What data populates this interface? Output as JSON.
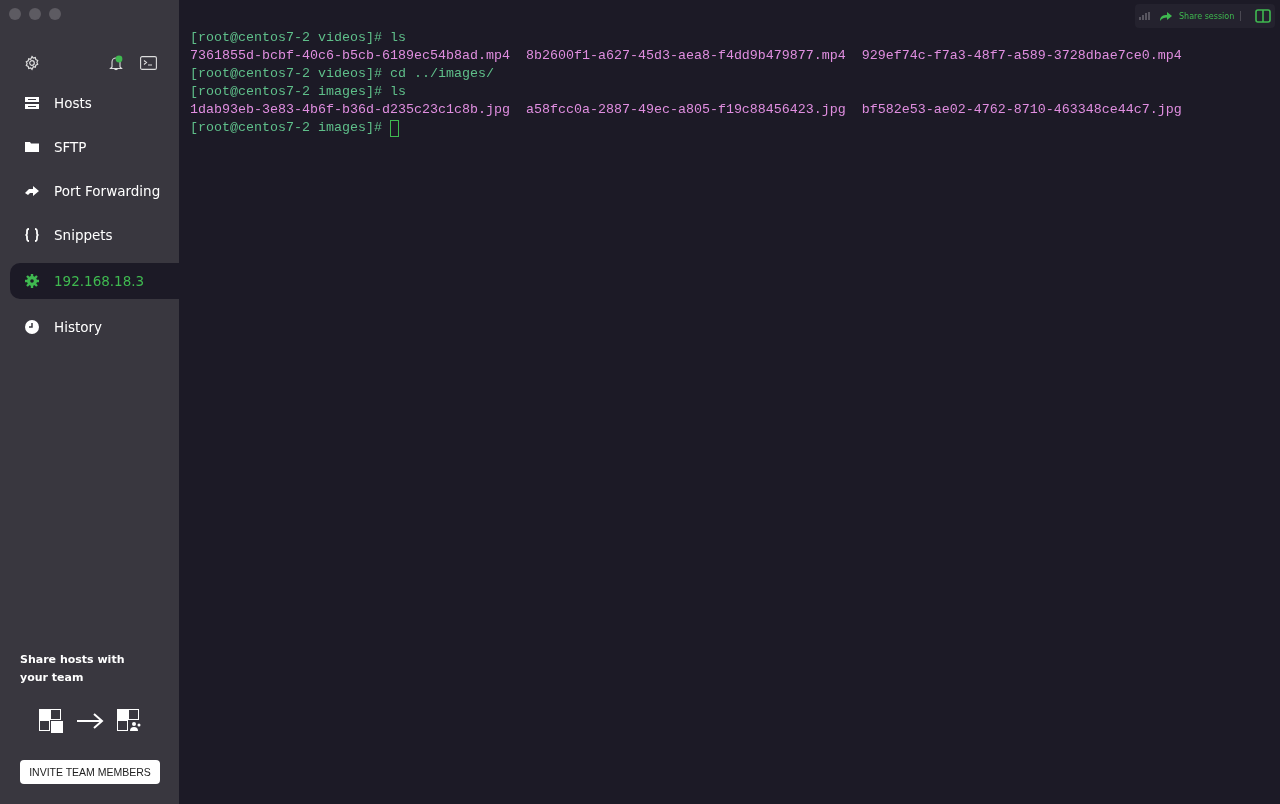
{
  "sidebar": {
    "items": [
      {
        "label": "Hosts",
        "kind": "hosts",
        "selected": false
      },
      {
        "label": "SFTP",
        "kind": "folder",
        "selected": false
      },
      {
        "label": "Port Forwarding",
        "kind": "forward",
        "selected": false
      },
      {
        "label": "Snippets",
        "kind": "braces",
        "selected": false
      },
      {
        "label": "192.168.18.3",
        "kind": "session",
        "selected": true
      },
      {
        "label": "History",
        "kind": "clock",
        "selected": false
      }
    ],
    "notifications_unread": true,
    "promo": {
      "title": "Share hosts with your team",
      "button": "INVITE TEAM MEMBERS"
    }
  },
  "toolbar": {
    "share_label": "Share session"
  },
  "terminal": {
    "lines": [
      {
        "kind": "prompt",
        "prompt": "[root@centos7-2 videos]# ",
        "command": "ls"
      },
      {
        "kind": "output",
        "text": "7361855d-bcbf-40c6-b5cb-6189ec54b8ad.mp4  8b2600f1-a627-45d3-aea8-f4dd9b479877.mp4  929ef74c-f7a3-48f7-a589-3728dbae7ce0.mp4"
      },
      {
        "kind": "prompt",
        "prompt": "[root@centos7-2 videos]# ",
        "command": "cd ../images/"
      },
      {
        "kind": "prompt",
        "prompt": "[root@centos7-2 images]# ",
        "command": "ls"
      },
      {
        "kind": "output",
        "text": "1dab93eb-3e83-4b6f-b36d-d235c23c1c8b.jpg  a58fcc0a-2887-49ec-a805-f19c88456423.jpg  bf582e53-ae02-4762-8710-463348ce44c7.jpg"
      },
      {
        "kind": "prompt",
        "prompt": "[root@centos7-2 images]# ",
        "cursor": true
      }
    ]
  }
}
